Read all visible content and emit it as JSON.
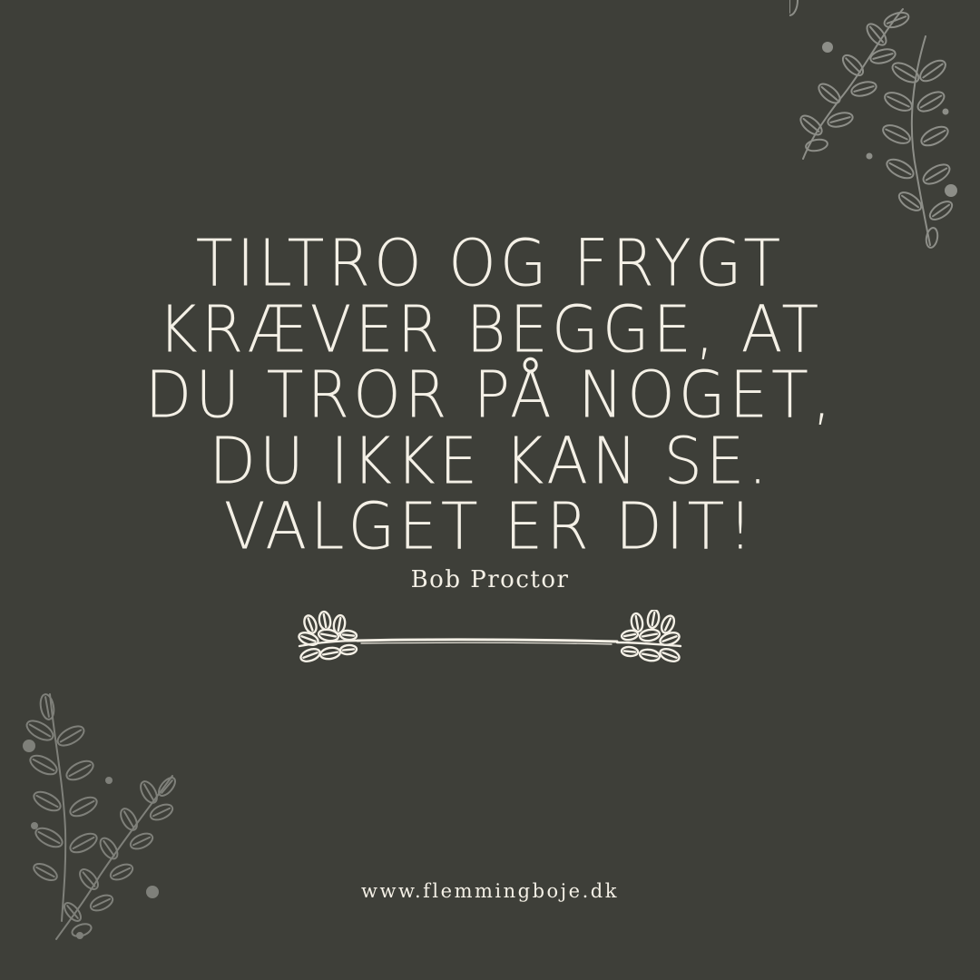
{
  "quote": {
    "lines": [
      "TILTRO OG FRYGT",
      "KRÆVER BEGGE, AT",
      "DU TROR PÅ NOGET,",
      "DU IKKE KAN SE.",
      "VALGET ER DIT!"
    ]
  },
  "author": "Bob Proctor",
  "website": "www.flemmingboje.dk",
  "decorations": {
    "top_right": "leafy-branch-icon",
    "bottom_left": "leafy-branch-icon",
    "divider": "laurel-divider-icon"
  },
  "colors": {
    "background": "#3e3f39",
    "text": "#f4f0e6",
    "branch": "#8d8e88"
  }
}
